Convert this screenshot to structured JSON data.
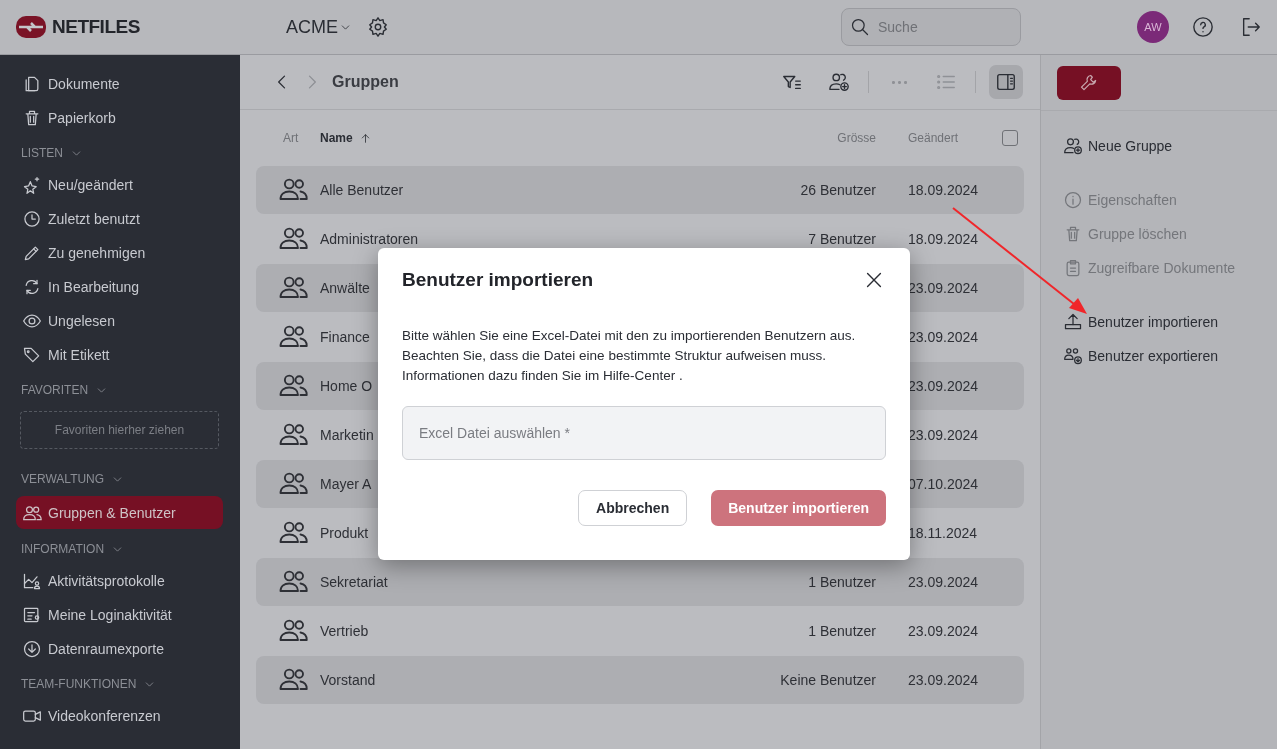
{
  "header": {
    "logo": "NETFILES",
    "workspace": "ACME",
    "search": {
      "placeholder": "Suche"
    },
    "avatar": "AW"
  },
  "sidebar": {
    "sections": [
      {
        "items": [
          {
            "label": "Dokumente",
            "selected": false
          },
          {
            "label": "Papierkorb",
            "selected": false
          }
        ]
      },
      {
        "title": "LISTEN",
        "expanded": true,
        "items": [
          {
            "label": "Neu/geändert",
            "selected": false
          },
          {
            "label": "Zuletzt benutzt",
            "selected": false
          },
          {
            "label": "Zu genehmigen",
            "selected": false
          },
          {
            "label": "In Bearbeitung",
            "selected": false
          },
          {
            "label": "Ungelesen",
            "selected": false
          },
          {
            "label": "Mit Etikett",
            "selected": false
          }
        ]
      },
      {
        "title": "FAVORITEN",
        "expanded": true,
        "dropzone": "Favoriten hierher ziehen"
      },
      {
        "title": "VERWALTUNG",
        "expanded": true,
        "items": [
          {
            "label": "Gruppen & Benutzer",
            "selected": true
          }
        ]
      },
      {
        "title": "INFORMATION",
        "expanded": true,
        "items": [
          {
            "label": "Aktivitätsprotokolle",
            "selected": false
          },
          {
            "label": "Meine Loginaktivität",
            "selected": false
          },
          {
            "label": "Datenraumexporte",
            "selected": false
          }
        ]
      },
      {
        "title": "TEAM-FUNKTIONEN",
        "expanded": true,
        "items": [
          {
            "label": "Videokonferenzen",
            "selected": false
          }
        ]
      }
    ]
  },
  "breadcrumb": {
    "current": "Gruppen"
  },
  "toolbar": [
    {
      "kind": "filter",
      "disabled": false,
      "selected": false
    },
    {
      "kind": "add-group",
      "disabled": false,
      "selected": false
    },
    {
      "kind": "more",
      "disabled": true,
      "selected": false
    },
    {
      "kind": "list",
      "disabled": true,
      "selected": false
    },
    {
      "kind": "panel",
      "disabled": false,
      "selected": true
    }
  ],
  "table": {
    "columns": [
      {
        "label": "Art"
      },
      {
        "label": "Name",
        "sort_ascending": true
      },
      {
        "label": "Grösse"
      },
      {
        "label": "Geändert"
      }
    ],
    "select_all": {
      "checked": false
    },
    "rows": [
      {
        "name": "Alle Benutzer",
        "size": "26 Benutzer",
        "changed": "18.09.2024"
      },
      {
        "name": "Administratoren",
        "size": "7 Benutzer",
        "changed": "18.09.2024"
      },
      {
        "name": "Anwälte",
        "changed": "23.09.2024"
      },
      {
        "name": "Finance",
        "changed": "23.09.2024"
      },
      {
        "name": "Home O",
        "changed": "23.09.2024"
      },
      {
        "name": "Marketin",
        "changed": "23.09.2024"
      },
      {
        "name": "Mayer A",
        "changed": "07.10.2024"
      },
      {
        "name": "Produkt",
        "changed": "18.11.2024"
      },
      {
        "name": "Sekretariat",
        "size": "1 Benutzer",
        "changed": "23.09.2024"
      },
      {
        "name": "Vertrieb",
        "size": "1 Benutzer",
        "changed": "23.09.2024"
      },
      {
        "name": "Vorstand",
        "size": "Keine Benutzer",
        "changed": "23.09.2024"
      }
    ]
  },
  "right_panel": {
    "action_groups": [
      [
        {
          "kind": "add-group",
          "label": "Neue Gruppe",
          "disabled": false
        }
      ],
      [
        {
          "kind": "info",
          "label": "Eigenschaften",
          "disabled": true
        },
        {
          "kind": "trash",
          "label": "Gruppe löschen",
          "disabled": true
        },
        {
          "kind": "clipboard",
          "label": "Zugreifbare Dokumente",
          "disabled": true
        }
      ],
      [
        {
          "kind": "upload",
          "label": "Benutzer importieren",
          "disabled": false
        },
        {
          "kind": "export",
          "label": "Benutzer exportieren",
          "disabled": false
        }
      ]
    ]
  },
  "dialog": {
    "title": "Benutzer importieren",
    "lines": [
      "Bitte wählen Sie eine Excel-Datei mit den zu importierenden Benutzern aus.",
      "Beachten Sie, dass die Datei eine bestimmte Struktur aufweisen muss.",
      "Informationen dazu finden Sie im Hilfe-Center ."
    ],
    "field": {
      "placeholder": "Excel Datei auswählen *"
    },
    "buttons": [
      {
        "label": "Abbrechen",
        "kind": "secondary",
        "disabled": false
      },
      {
        "label": "Benutzer importieren",
        "kind": "primary",
        "disabled": true
      }
    ]
  }
}
